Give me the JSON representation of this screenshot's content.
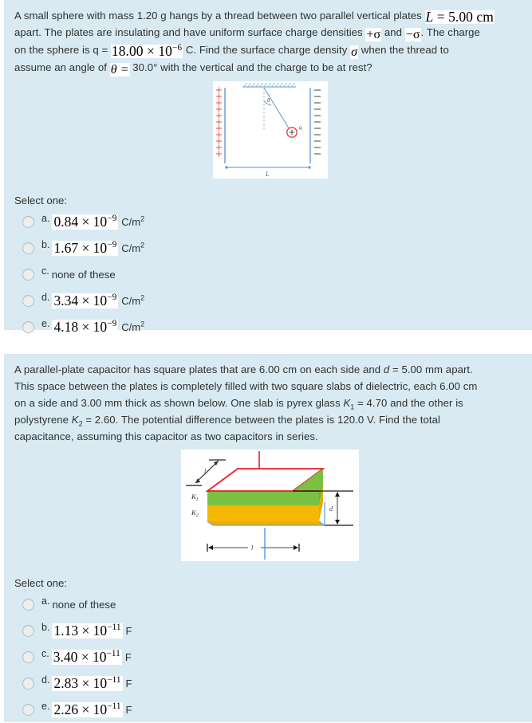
{
  "page": {
    "background": "#ffffff",
    "block_background": "#d9eaf3",
    "text_color": "#30312f"
  },
  "questions": [
    {
      "id": "q1",
      "text_runs": [
        {
          "t": "A small sphere with mass 1.20 g hangs by a thread between two parallel vertical plates ",
          "style": "plain"
        },
        {
          "t": "L = 5.00 cm",
          "style": "math-inline-italic-L"
        },
        {
          "t": " apart. The plates are insulating and have uniform surface charge densities ",
          "style": "plain"
        },
        {
          "t": "+σ",
          "style": "math"
        },
        {
          "t": " and ",
          "style": "plain"
        },
        {
          "t": "−σ",
          "style": "math"
        },
        {
          "t": ". The charge on the sphere is q = ",
          "style": "plain"
        },
        {
          "t": "18.00 × 10−6",
          "style": "math"
        },
        {
          "t": " C. Find the surface charge density ",
          "style": "plain"
        },
        {
          "t": "σ",
          "style": "math"
        },
        {
          "t": " when the thread to assume an angle of ",
          "style": "plain"
        },
        {
          "t": "θ =",
          "style": "math"
        },
        {
          "t": " 30.0° with the vertical and the charge to be at rest?",
          "style": "plain"
        }
      ],
      "line1_a": "A small sphere with mass 1.20 g hangs by a thread between two parallel vertical plates",
      "math_L": "L",
      "math_L_val": "= 5.00 cm",
      "line2_a": "apart. The plates are insulating and have uniform surface charge densities",
      "math_plus_sigma": "+σ",
      "line2_b": "and",
      "math_minus_sigma": "−σ",
      "line2_c": ". The charge",
      "line3_a": "on the sphere is q =",
      "math_q": "18.00 × 10",
      "math_q_exp": "−6",
      "line3_b": "C. Find the surface charge density",
      "math_sigma": "σ",
      "line3_c": "when the thread to",
      "line4_a": "assume an angle of",
      "math_theta": "θ =",
      "line4_b": "30.0° with the vertical and the charge to be at rest?",
      "figure": {
        "name": "sphere-between-plates-diagram",
        "left_plate_label": "+",
        "right_plate_label": "−",
        "angle_label": "θ",
        "charge_label": "q",
        "charge_symbol": "+",
        "width_label": "L"
      },
      "select_one": "Select one:",
      "options": [
        {
          "letter": "a.",
          "math": "0.84 × 10",
          "exp": "−9",
          "unit": "C/m",
          "unit_exp": "2",
          "plain": null
        },
        {
          "letter": "b.",
          "math": "1.67 × 10",
          "exp": "−9",
          "unit": "C/m",
          "unit_exp": "2",
          "plain": null
        },
        {
          "letter": "c.",
          "math": null,
          "exp": null,
          "unit": null,
          "unit_exp": null,
          "plain": "none of these"
        },
        {
          "letter": "d.",
          "math": "3.34 × 10",
          "exp": "−9",
          "unit": "C/m",
          "unit_exp": "2",
          "plain": null
        },
        {
          "letter": "e.",
          "math": "4.18 × 10",
          "exp": "−9",
          "unit": "C/m",
          "unit_exp": "2",
          "plain": null
        }
      ]
    },
    {
      "id": "q2",
      "line1": "A parallel-plate capacitor has square plates that are 6.00 cm on each side and d = 5.00 mm apart.",
      "line1_a": "A parallel-plate capacitor has square plates that are 6.00 cm on each side and ",
      "line1_d": "d",
      "line1_b": " = 5.00 mm apart.",
      "line2": "This space between the plates is completely filled with two square slabs of dielectric, each 6.00 cm",
      "line3_a": "on a side and 3.00 mm thick as shown below. One slab is pyrex glass ",
      "line3_K": "K",
      "line3_K_sub": "1",
      "line3_b": " = 4.70 and the other is",
      "line4_a": "polystyrene ",
      "line4_K": "K",
      "line4_K_sub": "2",
      "line4_b": " = 2.60. The potential difference between the plates is 120.0 V. Find the total",
      "line5": "capacitance, assuming this capacitor as two capacitors in series.",
      "figure": {
        "name": "two-dielectric-slab-capacitor-diagram",
        "k1_label": "K",
        "k1_sub": "1",
        "k2_label": "K",
        "k2_sub": "2",
        "length_label": "l",
        "depth_label": "l",
        "separation_label": "d",
        "slab1_color": "#7ac143",
        "slab2_color": "#f5b800",
        "top_plate_color": "#ee1c25",
        "bottom_plate_color": "#6ba7dd"
      },
      "select_one": "Select one:",
      "options": [
        {
          "letter": "a.",
          "math": null,
          "exp": null,
          "unit": null,
          "plain": "none of these"
        },
        {
          "letter": "b.",
          "math": "1.13 × 10",
          "exp": "−11",
          "unit": "F",
          "plain": null
        },
        {
          "letter": "c.",
          "math": "3.40 × 10",
          "exp": "−11",
          "unit": "F",
          "plain": null
        },
        {
          "letter": "d.",
          "math": "2.83 × 10",
          "exp": "−11",
          "unit": "F",
          "plain": null
        },
        {
          "letter": "e.",
          "math": "2.26 × 10",
          "exp": "−11",
          "unit": "F",
          "plain": null
        }
      ]
    }
  ]
}
